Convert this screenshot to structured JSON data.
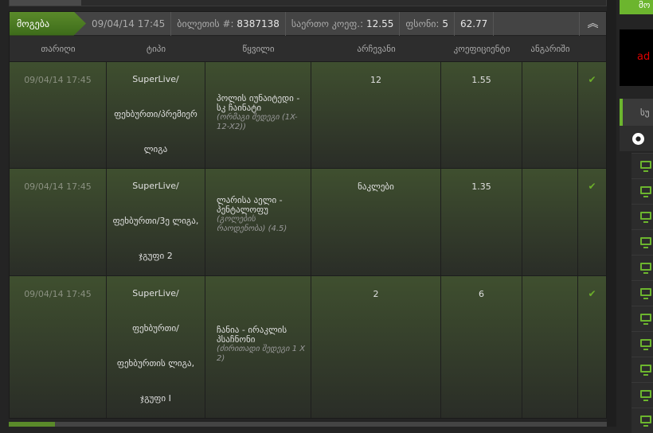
{
  "ticket": {
    "status": "მოგება",
    "datetime": "09/04/14 17:45",
    "ticket_label": "ბილეთის #:",
    "ticket_no": "8387138",
    "total_odds_label": "საერთო კოეფ.:",
    "total_odds": "12.55",
    "stake_label": "ფსონი:",
    "stake": "5",
    "payout": "62.77"
  },
  "columns": [
    "თარიღი",
    "ტიპი",
    "წყვილი",
    "არჩევანი",
    "კოეფიციენტი",
    "ანგარიში"
  ],
  "rows": [
    {
      "date": "09/04/14 17:45",
      "type": [
        "SuperLive/",
        "ფეხბურთი/პრემიერ",
        "ლიგა"
      ],
      "event": "პოლის იუნაიტედი - სკ ჩაინატი",
      "market": "(ორმაგი შედეგი (1X-12-X2))",
      "pick": "12",
      "odds": "1.55",
      "score": ""
    },
    {
      "date": "09/04/14 17:45",
      "type": [
        "SuperLive/",
        "ფეხბურთი/3ე ლიგა,",
        "ჯგუფი 2"
      ],
      "event": "ლარისა აელი - პენტალოფუ",
      "market": "(გოლების რაოდენობა) (4.5)",
      "pick": "ნაკლები",
      "odds": "1.35",
      "score": ""
    },
    {
      "date": "09/04/14 17:45",
      "type": [
        "SuperLive/",
        "ფეხბურთი/",
        "ფეხბურთის ლიგა,",
        "ჯგუფი I"
      ],
      "event": "ჩანია - ირაკლის პსაჩნონი",
      "market": "(ძირითადი შედეგი 1 X 2)",
      "pick": "2",
      "odds": "6",
      "score": ""
    }
  ],
  "sidebar": {
    "top_button": "მო",
    "ad_text": "ad",
    "tab_label": "სუ"
  }
}
